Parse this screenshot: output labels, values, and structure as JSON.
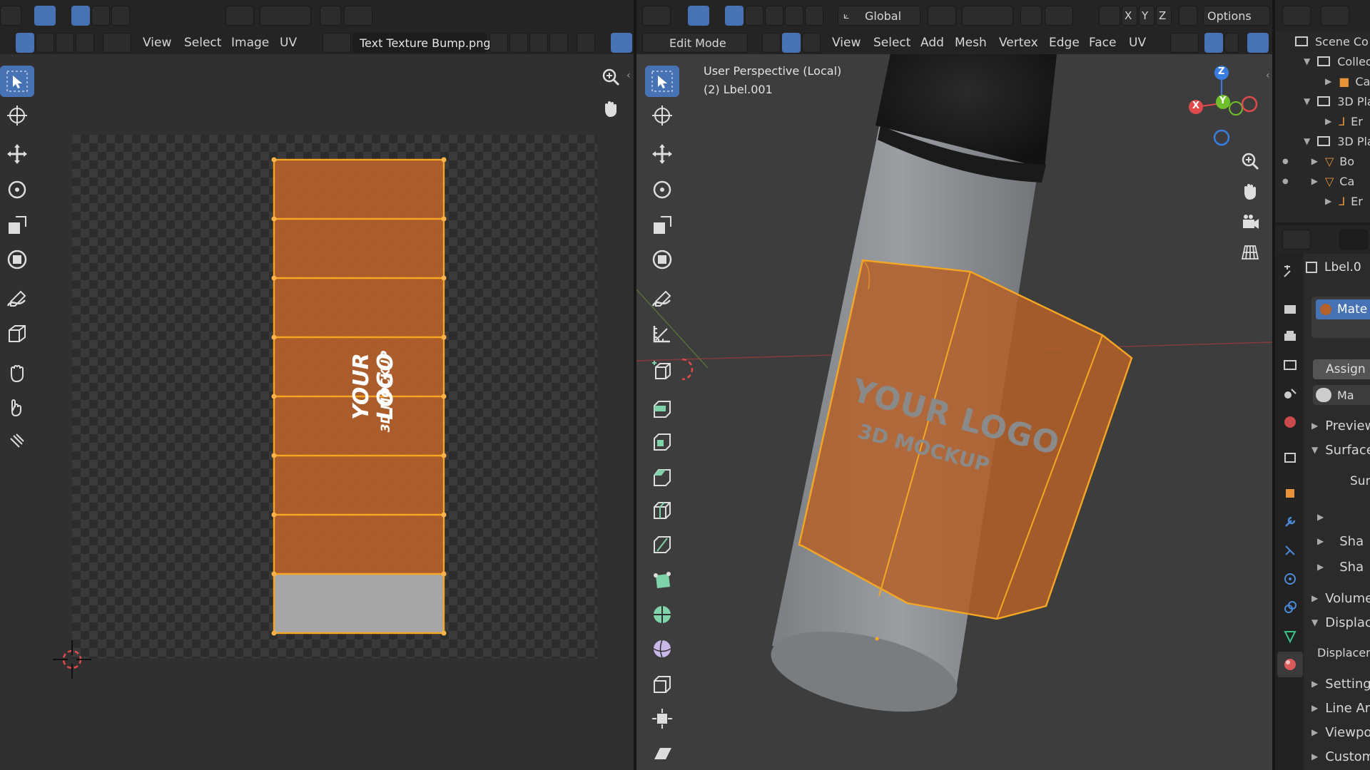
{
  "uv_editor": {
    "menus": [
      "View",
      "Select",
      "Image",
      "UV"
    ],
    "image_name": "Text Texture Bump.png",
    "label_logo_text": "YOUR LOGO",
    "label_sub_text": "3D MOCKUP"
  },
  "viewport": {
    "transform_orientation": "Global",
    "axes": [
      "X",
      "Y",
      "Z"
    ],
    "options_label": "Options",
    "mode": "Edit Mode",
    "menus": [
      "View",
      "Select",
      "Add",
      "Mesh",
      "Vertex",
      "Edge",
      "Face",
      "UV"
    ],
    "overlay_line1": "User Perspective (Local)",
    "overlay_line2": "(2) Lbel.001",
    "gizmo": {
      "x": "X",
      "y": "Y",
      "z": "Z"
    },
    "logo_text": "YOUR LOGO",
    "sub_text": "3D MOCKUP"
  },
  "outliner": {
    "rows": [
      {
        "label": "Scene Co",
        "indent": 0
      },
      {
        "label": "Collec",
        "indent": 1
      },
      {
        "label": "Ca",
        "indent": 2
      },
      {
        "label": "3D Pla",
        "indent": 1
      },
      {
        "label": "Er",
        "indent": 2
      },
      {
        "label": "3D Pla",
        "indent": 1
      },
      {
        "label": "Bo",
        "indent": 2
      },
      {
        "label": "Ca",
        "indent": 2
      },
      {
        "label": "Er",
        "indent": 2
      }
    ]
  },
  "properties": {
    "object_name": "Lbel.0",
    "material_slot": "Mate",
    "assign_label": "Assign",
    "material_name": "Ma",
    "sections": [
      {
        "label": "Preview",
        "open": false
      },
      {
        "label": "Surface",
        "open": true
      },
      {
        "label": "Surf",
        "open": null
      },
      {
        "label": "",
        "open": false
      },
      {
        "label": "Sha",
        "open": false
      },
      {
        "label": "Sha",
        "open": false
      },
      {
        "label": "Volume",
        "open": false
      },
      {
        "label": "Displac",
        "open": true
      },
      {
        "label": "Displacem",
        "open": null
      },
      {
        "label": "Settings",
        "open": false
      },
      {
        "label": "Line Art",
        "open": false
      },
      {
        "label": "Viewpo",
        "open": false
      },
      {
        "label": "Custom",
        "open": false
      }
    ]
  },
  "colors": {
    "accent": "#4772b3",
    "selection": "#f5a623",
    "label_orange": "#b5612a",
    "background": "#303030"
  }
}
